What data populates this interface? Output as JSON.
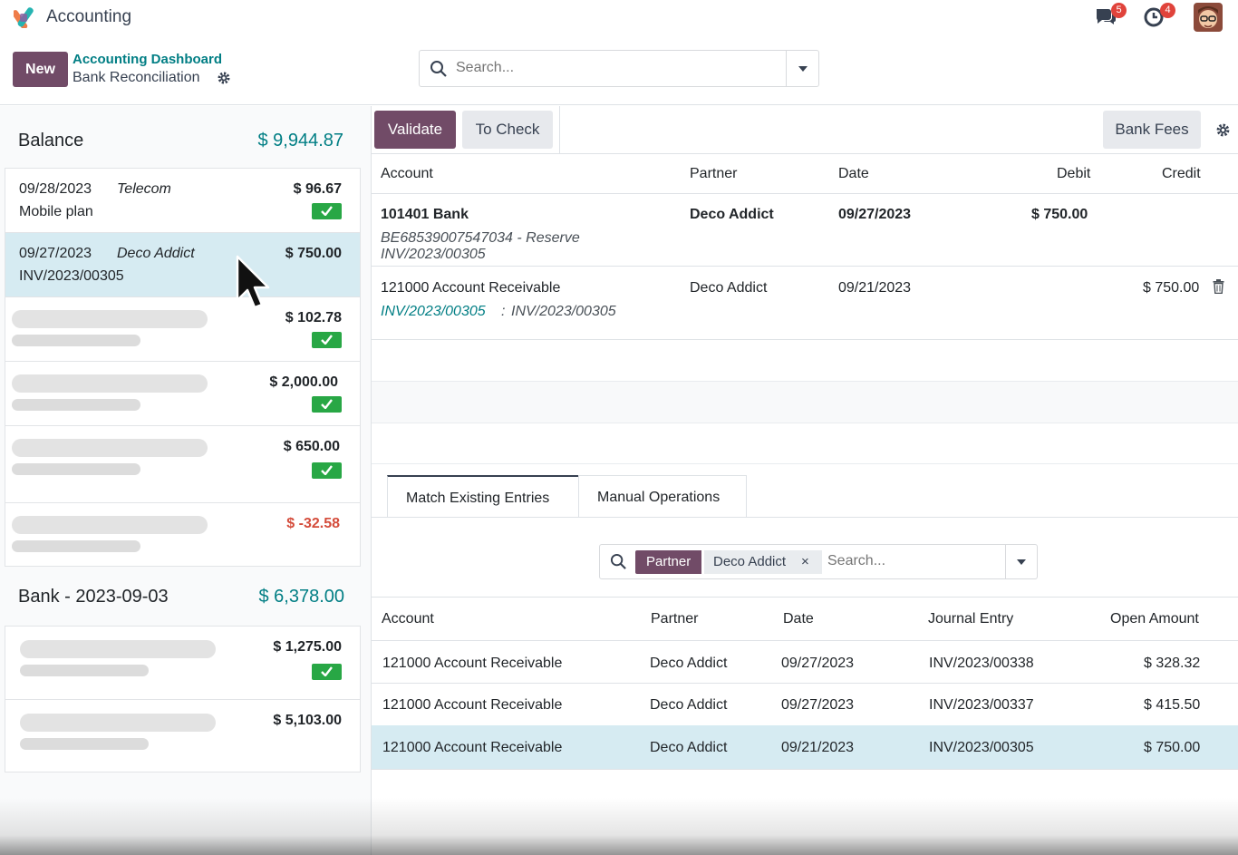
{
  "navbar": {
    "app_title": "Accounting",
    "messages_badge": "5",
    "activities_badge": "4",
    "icons": [
      "app-logo-icon",
      "chat-icon",
      "clock-icon",
      "user-avatar"
    ]
  },
  "control_panel": {
    "new_label": "New",
    "breadcrumb_parent": "Accounting Dashboard",
    "breadcrumb_current": "Bank Reconciliation",
    "search_placeholder": "Search..."
  },
  "left_panel": {
    "journals": [
      {
        "name": "Balance",
        "amount": "$ 9,944.87",
        "statements": [
          {
            "date": "09/28/2023",
            "partner": "Telecom",
            "label": "Mobile plan",
            "amount": "$ 96.67",
            "checked": true
          },
          {
            "date": "09/27/2023",
            "partner": "Deco Addict",
            "label": "INV/2023/00305",
            "amount": "$ 750.00",
            "checked": false,
            "selected": true
          },
          {
            "amount": "$ 102.78",
            "checked": true,
            "placeholder": true
          },
          {
            "amount": "$ 2,000.00",
            "checked": true,
            "placeholder": true
          },
          {
            "amount": "$ 650.00",
            "checked": true,
            "placeholder": true
          },
          {
            "amount": "$ -32.58",
            "checked": false,
            "placeholder": true
          }
        ]
      },
      {
        "name": "Bank - 2023-09-03",
        "amount": "$ 6,378.00",
        "statements": [
          {
            "amount": "$ 1,275.00",
            "checked": true,
            "placeholder": true
          },
          {
            "amount": "$ 5,103.00",
            "checked": false,
            "placeholder": true
          }
        ]
      }
    ]
  },
  "toolbar": {
    "validate_label": "Validate",
    "to_check_label": "To Check",
    "bank_fees_label": "Bank Fees"
  },
  "lines_table": {
    "headers": [
      "Account",
      "Partner",
      "Date",
      "Debit",
      "Credit"
    ],
    "rows": [
      {
        "account": "101401 Bank",
        "sub1": "BE68539007547034 - Reserve",
        "sub2": "INV/2023/00305",
        "partner": "Deco Addict",
        "date": "09/27/2023",
        "debit": "$ 750.00",
        "credit": ""
      },
      {
        "account": "121000 Account Receivable",
        "link": "INV/2023/00305",
        "sep": ":",
        "ref": "INV/2023/00305",
        "partner": "Deco Addict",
        "date": "09/21/2023",
        "debit": "",
        "credit": "$ 750.00"
      }
    ]
  },
  "tabs": [
    {
      "label": "Match Existing Entries",
      "active": true
    },
    {
      "label": "Manual Operations",
      "active": false
    }
  ],
  "match_search": {
    "facet_label": "Partner",
    "facet_value": "Deco Addict",
    "remove_glyph": "×",
    "placeholder": "Search..."
  },
  "match_table": {
    "headers": [
      "Account",
      "Partner",
      "Date",
      "Journal Entry",
      "Open Amount"
    ],
    "rows": [
      {
        "account": "121000 Account Receivable",
        "partner": "Deco Addict",
        "date": "09/27/2023",
        "entry": "INV/2023/00338",
        "amount": "$ 328.32",
        "selected": false
      },
      {
        "account": "121000 Account Receivable",
        "partner": "Deco Addict",
        "date": "09/27/2023",
        "entry": "INV/2023/00337",
        "amount": "$ 415.50",
        "selected": false
      },
      {
        "account": "121000 Account Receivable",
        "partner": "Deco Addict",
        "date": "09/21/2023",
        "entry": "INV/2023/00305",
        "amount": "$ 750.00",
        "selected": true
      }
    ]
  },
  "colors": {
    "primary": "#714b67",
    "teal": "#017e84",
    "selected_row": "#d6ebf2",
    "check_green": "#28a745",
    "negative": "#d44c3b"
  }
}
